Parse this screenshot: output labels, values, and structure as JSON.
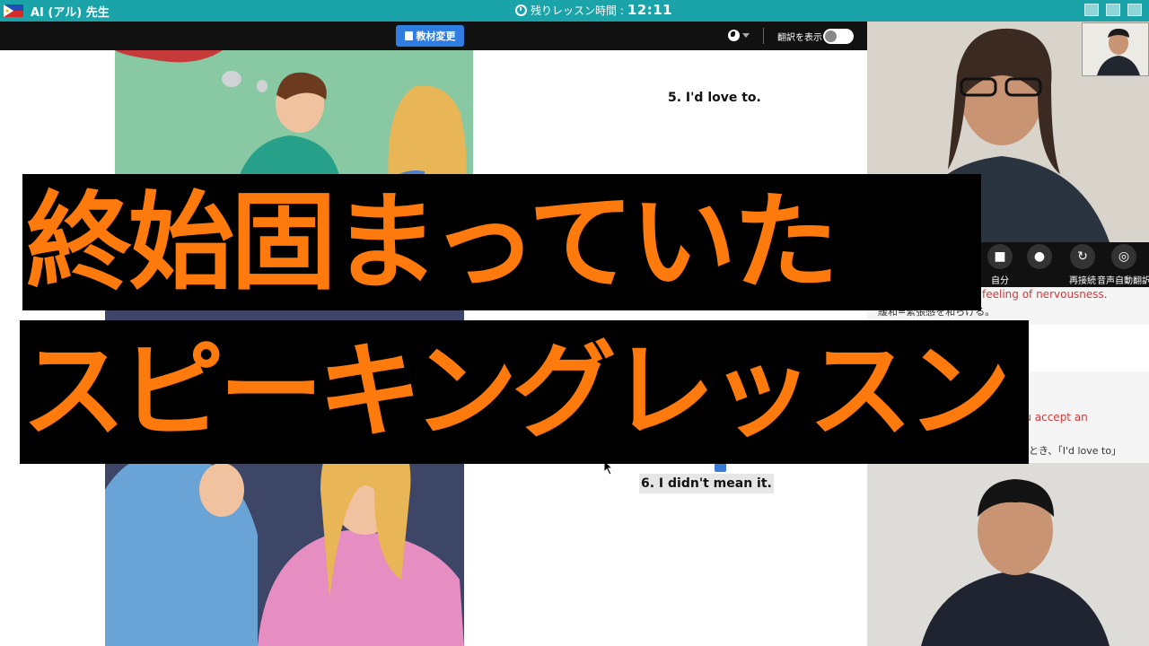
{
  "topbar": {
    "teacher_name": "AI (アル) 先生",
    "timer_label": "残りレッスン時間 :",
    "timer_value": "12:11",
    "flag_icon": "philippines-flag-icon",
    "accent_color": "#1aa3a8"
  },
  "toolbar": {
    "change_material_label": "教材変更",
    "translate_label": "翻訳を表示"
  },
  "lesson": {
    "phrase_5": "5. I'd love to.",
    "phrase_6": "6. I didn't mean it."
  },
  "video_controls": {
    "self_label": "自分",
    "reconnect_label": "再接続",
    "auto_translate_label": "音声自動翻訳"
  },
  "vocab": {
    "item1_en": "feeling of nervousness.",
    "item1_jp": "緩和=緊張感を和らげる。",
    "item2_en": "ou accept an",
    "item2_jp": "とき、「I'd love to」"
  },
  "captions": {
    "line1": "終始固まっていた",
    "line2": "スピーキングレッスン",
    "color": "#ff7a0d"
  }
}
